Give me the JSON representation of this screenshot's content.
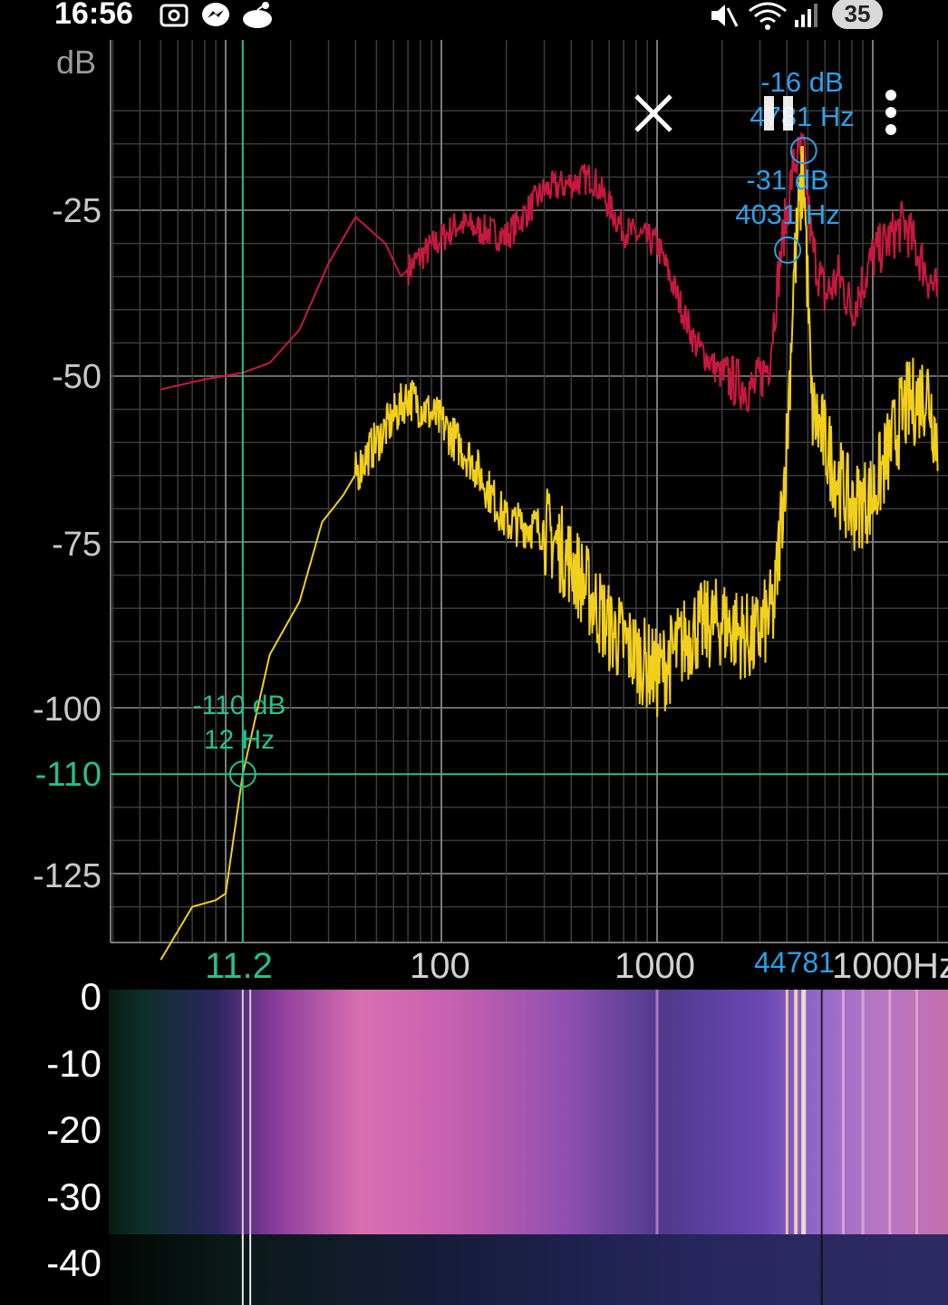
{
  "status_bar": {
    "time": "16:56",
    "left_icons": [
      "screenshot-icon",
      "messenger-icon",
      "reddit-icon"
    ],
    "right_icons": [
      "mute-icon",
      "wifi-icon",
      "signal-icon"
    ],
    "battery_percent": "35"
  },
  "toolbar": {
    "close_icon": "close-icon",
    "pause_icon": "pause-icon",
    "menu_icon": "more-vertical-icon"
  },
  "spectrum": {
    "y_unit": "dB",
    "y_ticks": [
      "-25",
      "-50",
      "-75",
      "-100",
      "-125"
    ],
    "cursor_y_label": "-110",
    "x_ticks": [
      "100",
      "1000"
    ],
    "x_cursor_label": "11.2",
    "x_peak_label": "44781",
    "x_end_label": "1000Hz",
    "cursor_readout": {
      "db": "-110 dB",
      "hz": "12 Hz"
    },
    "peak_readout_1": {
      "db": "-16 dB",
      "hz": "4781 Hz"
    },
    "peak_readout_2": {
      "db": "-31 dB",
      "hz": "4031 Hz"
    },
    "colors": {
      "peak_hold": "#c8183f",
      "live": "#f2cf1b",
      "cursor": "#27c08a",
      "peak_marker": "#2f9fe6",
      "grid": "#555555"
    }
  },
  "spectrogram": {
    "y_ticks": [
      "0",
      "-10",
      "-20",
      "-30",
      "-40"
    ]
  }
}
